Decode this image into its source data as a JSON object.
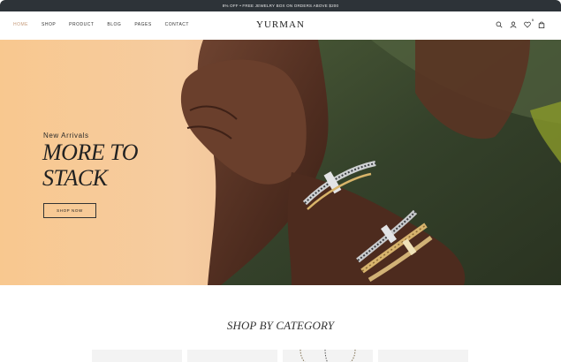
{
  "announcement": "8% OFF • FREE JEWELRY BOX ON ORDERS ABOVE $200",
  "header": {
    "logo": "YURMAN",
    "nav": [
      {
        "label": "HOME",
        "active": true
      },
      {
        "label": "SHOP",
        "active": false
      },
      {
        "label": "PRODUCT",
        "active": false
      },
      {
        "label": "BLOG",
        "active": false
      },
      {
        "label": "PAGES",
        "active": false
      },
      {
        "label": "CONTACT",
        "active": false
      }
    ],
    "icons": [
      "search-icon",
      "user-icon",
      "heart-icon",
      "bag-icon"
    ],
    "wishlist_count": "0"
  },
  "hero": {
    "subtitle": "New Arrivals",
    "title": "MORE TO STACK",
    "button": "SHOP NOW"
  },
  "category": {
    "title": "SHOP BY CATEGORY"
  },
  "colors": {
    "announcement_bg": "#2d3338",
    "accent": "#c59a7a",
    "hero_peach": "#f7c68d",
    "hero_green": "#3a4a2c"
  }
}
